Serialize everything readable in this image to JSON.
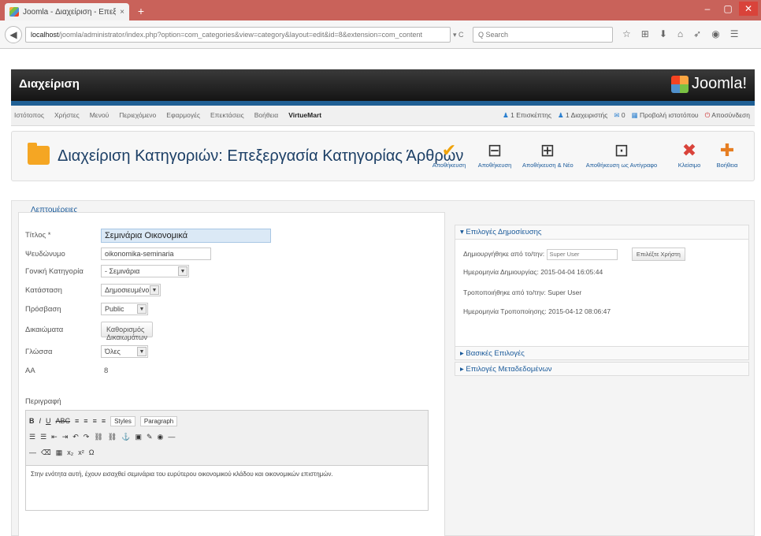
{
  "browser": {
    "tab_title": "Joomla - Διαχείριση - Επεξ...",
    "tab_close": "×",
    "new_tab": "+",
    "window_buttons": [
      "–",
      "▢",
      "✕"
    ],
    "back": "◀",
    "address_host": "localhost",
    "address_rest": "/joomla/administrator/index.php?option=com_categories&view=category&layout=edit&id=8&extension=com_content",
    "reload": "▾ C",
    "search_placeholder": "Q Search",
    "icons": [
      "☆",
      "⊞",
      "⬇",
      "⌂",
      "➶",
      "◉",
      "☰"
    ]
  },
  "joomla": {
    "admin_title": "Διαχείριση",
    "logo_text": "Joomla!",
    "menu": [
      "Ιστότοπος",
      "Χρήστες",
      "Μενού",
      "Περιεχόμενο",
      "Εφαρμογές",
      "Επεκτάσεις",
      "Βοήθεια",
      "VirtueMart"
    ],
    "status": [
      {
        "icon": "♟",
        "text": "1 Επισκέπτης"
      },
      {
        "icon": "♟",
        "text": "1 Διαχειριστής"
      },
      {
        "icon": "✉",
        "text": "0"
      },
      {
        "icon": "▦",
        "text": "Προβολή ιστοτόπου"
      },
      {
        "icon": "⏻",
        "text": "Αποσύνδεση"
      }
    ]
  },
  "toolbar": {
    "title": "Διαχείριση Κατηγοριών: Επεξεργασία Κατηγορίας Άρθρων",
    "buttons": [
      {
        "icon": "✔",
        "label": "Αποθήκευση",
        "color": "#f0a30a"
      },
      {
        "icon": "⊟",
        "label": "Αποθήκευση",
        "color": "#333"
      },
      {
        "icon": "⊞",
        "label": "Αποθήκευση & Νέο",
        "color": "#333"
      },
      {
        "icon": "⊡",
        "label": "Αποθήκευση ως Αντίγραφο",
        "color": "#333"
      },
      {
        "icon": "✖",
        "label": "Κλείσιμο",
        "color": "#d9433a"
      },
      {
        "icon": "✚",
        "label": "Βοήθεια",
        "color": "#e67e22"
      }
    ]
  },
  "form": {
    "legend": "Λεπτομέρειες",
    "fields": [
      {
        "label": "Τίτλος *",
        "value": "Σεμινάρια Οικονομικά",
        "type": "title"
      },
      {
        "label": "Ψευδώνυμο",
        "value": "oikonomika-seminaria",
        "type": "text"
      },
      {
        "label": "Γονική Κατηγορία",
        "value": "- Σεμινάρια",
        "type": "select"
      },
      {
        "label": "Κατάσταση",
        "value": "Δημοσιευμένο",
        "type": "select"
      },
      {
        "label": "Πρόσβαση",
        "value": "Public",
        "type": "select"
      },
      {
        "label": "Δικαιώματα",
        "value": "Καθορισμός Δικαιωμάτων",
        "type": "button"
      },
      {
        "label": "Γλώσσα",
        "value": "Όλες",
        "type": "select"
      },
      {
        "label": "ΑΑ",
        "value": "8",
        "type": "static"
      }
    ],
    "description_label": "Περιγραφή",
    "editor": {
      "row1": [
        "B",
        "I",
        "U",
        "ABC",
        "≡",
        "≡",
        "≡",
        "≡"
      ],
      "styles": "Styles",
      "paragraph": "Paragraph",
      "row2": [
        "☰",
        "☰",
        "⇤",
        "⇥",
        "↶",
        "↷",
        "⛓",
        "⛓",
        "⚓",
        "▣",
        "✎",
        "◉",
        "—"
      ],
      "row3": [
        "—",
        "⌫",
        "▦",
        "x₂",
        "x²",
        "Ω"
      ],
      "body": "Στην ενότητα αυτή, έχουν εισαχθεί σεμινάρια του ευρύτερου οικονομικού κλάδου και οικονομικών επιστημών."
    }
  },
  "publishing": {
    "header": "▾ Επιλογές Δημοσίευσης",
    "created_by_label": "Δημιουργήθηκε από το/την:",
    "created_by_value": "Super User",
    "select_user": "Επιλέξτε Χρήστη",
    "created_date_label": "Ημερομηνία Δημιουργίας:",
    "created_date_value": "2015-04-04 16:05:44",
    "modified_by_label": "Τροποποιήθηκε από το/την:",
    "modified_by_value": "Super User",
    "modified_date_label": "Ημερομηνία Τροποποίησης:",
    "modified_date_value": "2015-04-12 08:06:47",
    "basic_options": "▸ Βασικές Επιλογές",
    "metadata_options": "▸ Επιλογές Μεταδεδομένων"
  }
}
